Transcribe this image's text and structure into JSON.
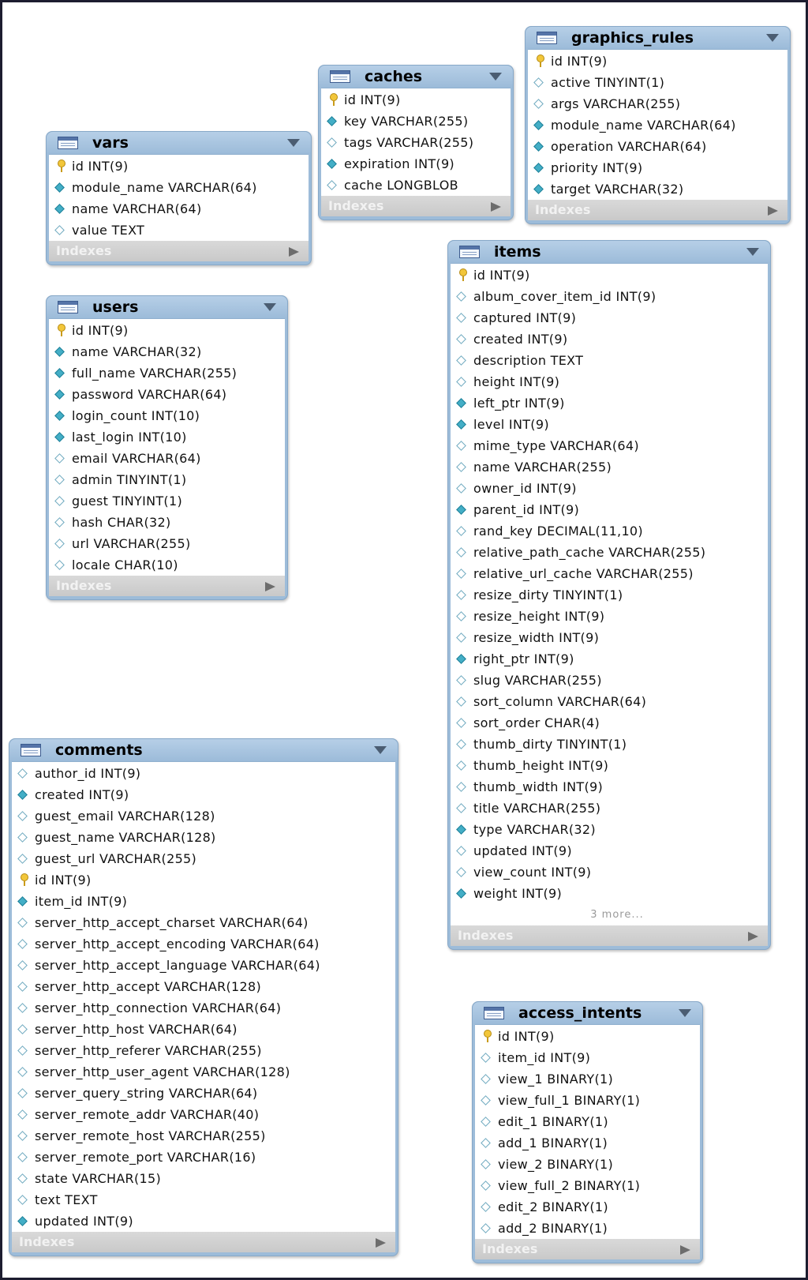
{
  "tables": [
    {
      "name": "vars",
      "indexes_label": "Indexes",
      "more": "",
      "columns": [
        {
          "text": "id INT(9)",
          "icon": "key-icon"
        },
        {
          "text": "module_name VARCHAR(64)",
          "icon": "filled-diamond-icon"
        },
        {
          "text": "name VARCHAR(64)",
          "icon": "filled-diamond-icon"
        },
        {
          "text": "value TEXT",
          "icon": "hollow-diamond-icon"
        }
      ]
    },
    {
      "name": "caches",
      "indexes_label": "Indexes",
      "more": "",
      "columns": [
        {
          "text": "id INT(9)",
          "icon": "key-icon"
        },
        {
          "text": "key VARCHAR(255)",
          "icon": "filled-diamond-icon"
        },
        {
          "text": "tags VARCHAR(255)",
          "icon": "hollow-diamond-icon"
        },
        {
          "text": "expiration INT(9)",
          "icon": "filled-diamond-icon"
        },
        {
          "text": "cache LONGBLOB",
          "icon": "hollow-diamond-icon"
        }
      ]
    },
    {
      "name": "graphics_rules",
      "indexes_label": "Indexes",
      "more": "",
      "columns": [
        {
          "text": "id INT(9)",
          "icon": "key-icon"
        },
        {
          "text": "active TINYINT(1)",
          "icon": "hollow-diamond-icon"
        },
        {
          "text": "args VARCHAR(255)",
          "icon": "hollow-diamond-icon"
        },
        {
          "text": "module_name VARCHAR(64)",
          "icon": "filled-diamond-icon"
        },
        {
          "text": "operation VARCHAR(64)",
          "icon": "filled-diamond-icon"
        },
        {
          "text": "priority INT(9)",
          "icon": "filled-diamond-icon"
        },
        {
          "text": "target VARCHAR(32)",
          "icon": "filled-diamond-icon"
        }
      ]
    },
    {
      "name": "users",
      "indexes_label": "Indexes",
      "more": "",
      "columns": [
        {
          "text": "id INT(9)",
          "icon": "key-icon"
        },
        {
          "text": "name VARCHAR(32)",
          "icon": "filled-diamond-icon"
        },
        {
          "text": "full_name VARCHAR(255)",
          "icon": "filled-diamond-icon"
        },
        {
          "text": "password VARCHAR(64)",
          "icon": "filled-diamond-icon"
        },
        {
          "text": "login_count INT(10)",
          "icon": "filled-diamond-icon"
        },
        {
          "text": "last_login INT(10)",
          "icon": "filled-diamond-icon"
        },
        {
          "text": "email VARCHAR(64)",
          "icon": "hollow-diamond-icon"
        },
        {
          "text": "admin TINYINT(1)",
          "icon": "hollow-diamond-icon"
        },
        {
          "text": "guest TINYINT(1)",
          "icon": "hollow-diamond-icon"
        },
        {
          "text": "hash CHAR(32)",
          "icon": "hollow-diamond-icon"
        },
        {
          "text": "url VARCHAR(255)",
          "icon": "hollow-diamond-icon"
        },
        {
          "text": "locale CHAR(10)",
          "icon": "hollow-diamond-icon"
        }
      ]
    },
    {
      "name": "items",
      "indexes_label": "Indexes",
      "more": "3 more...",
      "columns": [
        {
          "text": "id INT(9)",
          "icon": "key-icon"
        },
        {
          "text": "album_cover_item_id INT(9)",
          "icon": "hollow-diamond-icon"
        },
        {
          "text": "captured INT(9)",
          "icon": "hollow-diamond-icon"
        },
        {
          "text": "created INT(9)",
          "icon": "hollow-diamond-icon"
        },
        {
          "text": "description TEXT",
          "icon": "hollow-diamond-icon"
        },
        {
          "text": "height INT(9)",
          "icon": "hollow-diamond-icon"
        },
        {
          "text": "left_ptr INT(9)",
          "icon": "filled-diamond-icon"
        },
        {
          "text": "level INT(9)",
          "icon": "filled-diamond-icon"
        },
        {
          "text": "mime_type VARCHAR(64)",
          "icon": "hollow-diamond-icon"
        },
        {
          "text": "name VARCHAR(255)",
          "icon": "hollow-diamond-icon"
        },
        {
          "text": "owner_id INT(9)",
          "icon": "hollow-diamond-icon"
        },
        {
          "text": "parent_id INT(9)",
          "icon": "filled-diamond-icon"
        },
        {
          "text": "rand_key DECIMAL(11,10)",
          "icon": "hollow-diamond-icon"
        },
        {
          "text": "relative_path_cache VARCHAR(255)",
          "icon": "hollow-diamond-icon"
        },
        {
          "text": "relative_url_cache VARCHAR(255)",
          "icon": "hollow-diamond-icon"
        },
        {
          "text": "resize_dirty TINYINT(1)",
          "icon": "hollow-diamond-icon"
        },
        {
          "text": "resize_height INT(9)",
          "icon": "hollow-diamond-icon"
        },
        {
          "text": "resize_width INT(9)",
          "icon": "hollow-diamond-icon"
        },
        {
          "text": "right_ptr INT(9)",
          "icon": "filled-diamond-icon"
        },
        {
          "text": "slug VARCHAR(255)",
          "icon": "hollow-diamond-icon"
        },
        {
          "text": "sort_column VARCHAR(64)",
          "icon": "hollow-diamond-icon"
        },
        {
          "text": "sort_order CHAR(4)",
          "icon": "hollow-diamond-icon"
        },
        {
          "text": "thumb_dirty TINYINT(1)",
          "icon": "hollow-diamond-icon"
        },
        {
          "text": "thumb_height INT(9)",
          "icon": "hollow-diamond-icon"
        },
        {
          "text": "thumb_width INT(9)",
          "icon": "hollow-diamond-icon"
        },
        {
          "text": "title VARCHAR(255)",
          "icon": "hollow-diamond-icon"
        },
        {
          "text": "type VARCHAR(32)",
          "icon": "filled-diamond-icon"
        },
        {
          "text": "updated INT(9)",
          "icon": "hollow-diamond-icon"
        },
        {
          "text": "view_count INT(9)",
          "icon": "hollow-diamond-icon"
        },
        {
          "text": "weight INT(9)",
          "icon": "filled-diamond-icon"
        }
      ]
    },
    {
      "name": "comments",
      "indexes_label": "Indexes",
      "more": "",
      "columns": [
        {
          "text": "author_id INT(9)",
          "icon": "hollow-diamond-icon"
        },
        {
          "text": "created INT(9)",
          "icon": "filled-diamond-icon"
        },
        {
          "text": "guest_email VARCHAR(128)",
          "icon": "hollow-diamond-icon"
        },
        {
          "text": "guest_name VARCHAR(128)",
          "icon": "hollow-diamond-icon"
        },
        {
          "text": "guest_url VARCHAR(255)",
          "icon": "hollow-diamond-icon"
        },
        {
          "text": "id INT(9)",
          "icon": "key-icon"
        },
        {
          "text": "item_id INT(9)",
          "icon": "filled-diamond-icon"
        },
        {
          "text": "server_http_accept_charset VARCHAR(64)",
          "icon": "hollow-diamond-icon"
        },
        {
          "text": "server_http_accept_encoding VARCHAR(64)",
          "icon": "hollow-diamond-icon"
        },
        {
          "text": "server_http_accept_language VARCHAR(64)",
          "icon": "hollow-diamond-icon"
        },
        {
          "text": "server_http_accept VARCHAR(128)",
          "icon": "hollow-diamond-icon"
        },
        {
          "text": "server_http_connection VARCHAR(64)",
          "icon": "hollow-diamond-icon"
        },
        {
          "text": "server_http_host VARCHAR(64)",
          "icon": "hollow-diamond-icon"
        },
        {
          "text": "server_http_referer VARCHAR(255)",
          "icon": "hollow-diamond-icon"
        },
        {
          "text": "server_http_user_agent VARCHAR(128)",
          "icon": "hollow-diamond-icon"
        },
        {
          "text": "server_query_string VARCHAR(64)",
          "icon": "hollow-diamond-icon"
        },
        {
          "text": "server_remote_addr VARCHAR(40)",
          "icon": "hollow-diamond-icon"
        },
        {
          "text": "server_remote_host VARCHAR(255)",
          "icon": "hollow-diamond-icon"
        },
        {
          "text": "server_remote_port VARCHAR(16)",
          "icon": "hollow-diamond-icon"
        },
        {
          "text": "state VARCHAR(15)",
          "icon": "hollow-diamond-icon"
        },
        {
          "text": "text TEXT",
          "icon": "hollow-diamond-icon"
        },
        {
          "text": "updated INT(9)",
          "icon": "filled-diamond-icon"
        }
      ]
    },
    {
      "name": "access_intents",
      "indexes_label": "Indexes",
      "more": "",
      "columns": [
        {
          "text": "id INT(9)",
          "icon": "key-icon"
        },
        {
          "text": "item_id INT(9)",
          "icon": "hollow-diamond-icon"
        },
        {
          "text": "view_1 BINARY(1)",
          "icon": "hollow-diamond-icon"
        },
        {
          "text": "view_full_1 BINARY(1)",
          "icon": "hollow-diamond-icon"
        },
        {
          "text": "edit_1 BINARY(1)",
          "icon": "hollow-diamond-icon"
        },
        {
          "text": "add_1 BINARY(1)",
          "icon": "hollow-diamond-icon"
        },
        {
          "text": "view_2 BINARY(1)",
          "icon": "hollow-diamond-icon"
        },
        {
          "text": "view_full_2 BINARY(1)",
          "icon": "hollow-diamond-icon"
        },
        {
          "text": "edit_2 BINARY(1)",
          "icon": "hollow-diamond-icon"
        },
        {
          "text": "add_2 BINARY(1)",
          "icon": "hollow-diamond-icon"
        }
      ]
    }
  ]
}
